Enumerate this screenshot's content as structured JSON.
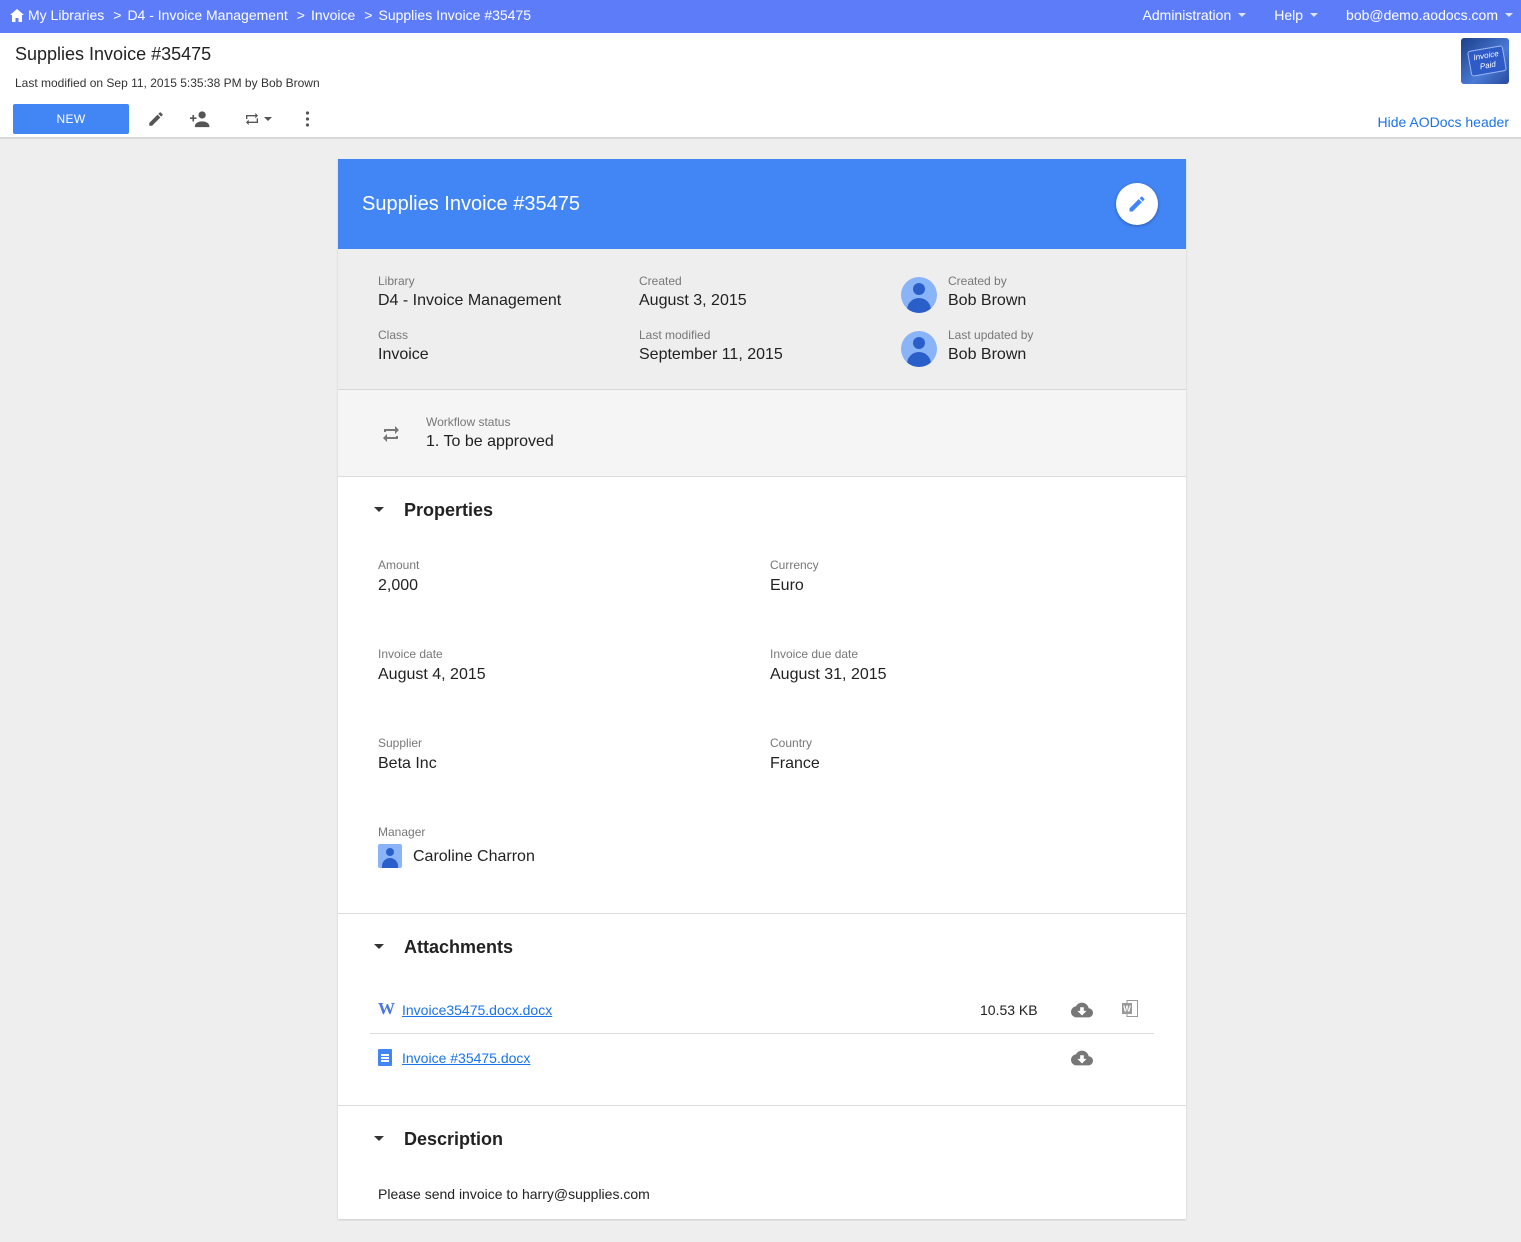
{
  "nav": {
    "breadcrumbs": [
      "My Libraries",
      "D4 - Invoice Management",
      "Invoice",
      "Supplies Invoice #35475"
    ],
    "separator": ">",
    "menus": [
      "Administration",
      "Help",
      "bob@demo.aodocs.com"
    ]
  },
  "header": {
    "title": "Supplies Invoice #35475",
    "meta": "Last modified on Sep 11, 2015 5:35:38 PM by Bob Brown",
    "new_label": "NEW",
    "hide_header": "Hide AODocs header",
    "thumbnail_text": "Invoice Paid"
  },
  "card": {
    "title": "Supplies Invoice #35475",
    "info": {
      "library_label": "Library",
      "library": "D4 - Invoice Management",
      "class_label": "Class",
      "class": "Invoice",
      "created_label": "Created",
      "created": "August 3, 2015",
      "modified_label": "Last modified",
      "modified": "September 11, 2015",
      "created_by_label": "Created by",
      "created_by": "Bob Brown",
      "updated_by_label": "Last updated by",
      "updated_by": "Bob Brown"
    },
    "workflow": {
      "label": "Workflow status",
      "value": "1. To be approved"
    },
    "properties": {
      "title": "Properties",
      "amount_label": "Amount",
      "amount": "2,000",
      "currency_label": "Currency",
      "currency": "Euro",
      "invoice_date_label": "Invoice date",
      "invoice_date": "August 4, 2015",
      "due_date_label": "Invoice due date",
      "due_date": "August 31, 2015",
      "supplier_label": "Supplier",
      "supplier": "Beta Inc",
      "country_label": "Country",
      "country": "France",
      "manager_label": "Manager",
      "manager": "Caroline Charron"
    },
    "attachments": {
      "title": "Attachments",
      "items": [
        {
          "name": "Invoice35475.docx.docx",
          "size": "10.53 KB",
          "type": "word-icon"
        },
        {
          "name": "Invoice #35475.docx",
          "size": "",
          "type": "google-doc-icon"
        }
      ]
    },
    "description": {
      "title": "Description",
      "text": "Please send invoice to harry@supplies.com"
    }
  },
  "colors": {
    "nav": "#5c7cfa",
    "accent": "#4285f4",
    "link": "#1a73e8",
    "background": "#eeeeee"
  }
}
